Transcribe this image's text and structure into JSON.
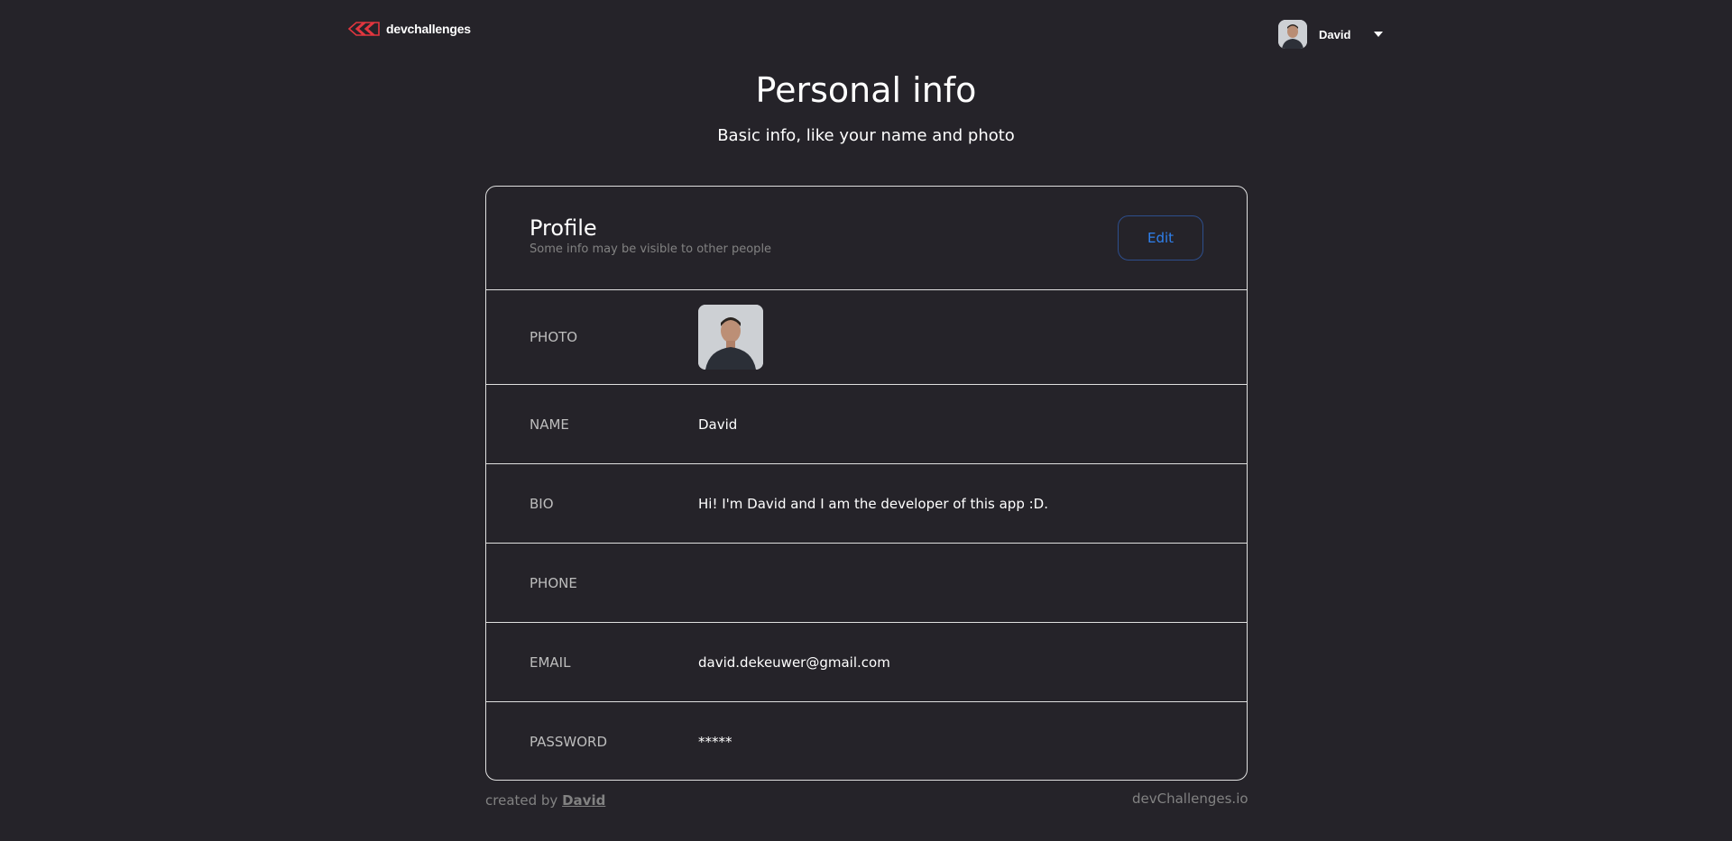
{
  "header": {
    "logo_text": "devchallenges",
    "user_name": "David",
    "logo_color": "#E2363F"
  },
  "page": {
    "title": "Personal info",
    "subtitle": "Basic info, like your name and photo"
  },
  "profile": {
    "title": "Profile",
    "description": "Some info may be visible to other people",
    "edit_label": "Edit",
    "rows": {
      "photo": {
        "label": "PHOTO"
      },
      "name": {
        "label": "NAME",
        "value": "David"
      },
      "bio": {
        "label": "BIO",
        "value": "Hi! I'm David and I am the developer of this app :D."
      },
      "phone": {
        "label": "PHONE",
        "value": ""
      },
      "email": {
        "label": "EMAIL",
        "value": "david.dekeuwer@gmail.com"
      },
      "password": {
        "label": "PASSWORD",
        "value": "*****"
      }
    }
  },
  "footer": {
    "created_by_prefix": "created by",
    "author": "David",
    "site": "devChallenges.io"
  },
  "icons": {
    "logo": "devchallenges-logo-icon",
    "dropdown": "caret-down-icon"
  },
  "colors": {
    "background": "#252329",
    "accent": "#2F80ED",
    "border": "#E0E0E0"
  }
}
